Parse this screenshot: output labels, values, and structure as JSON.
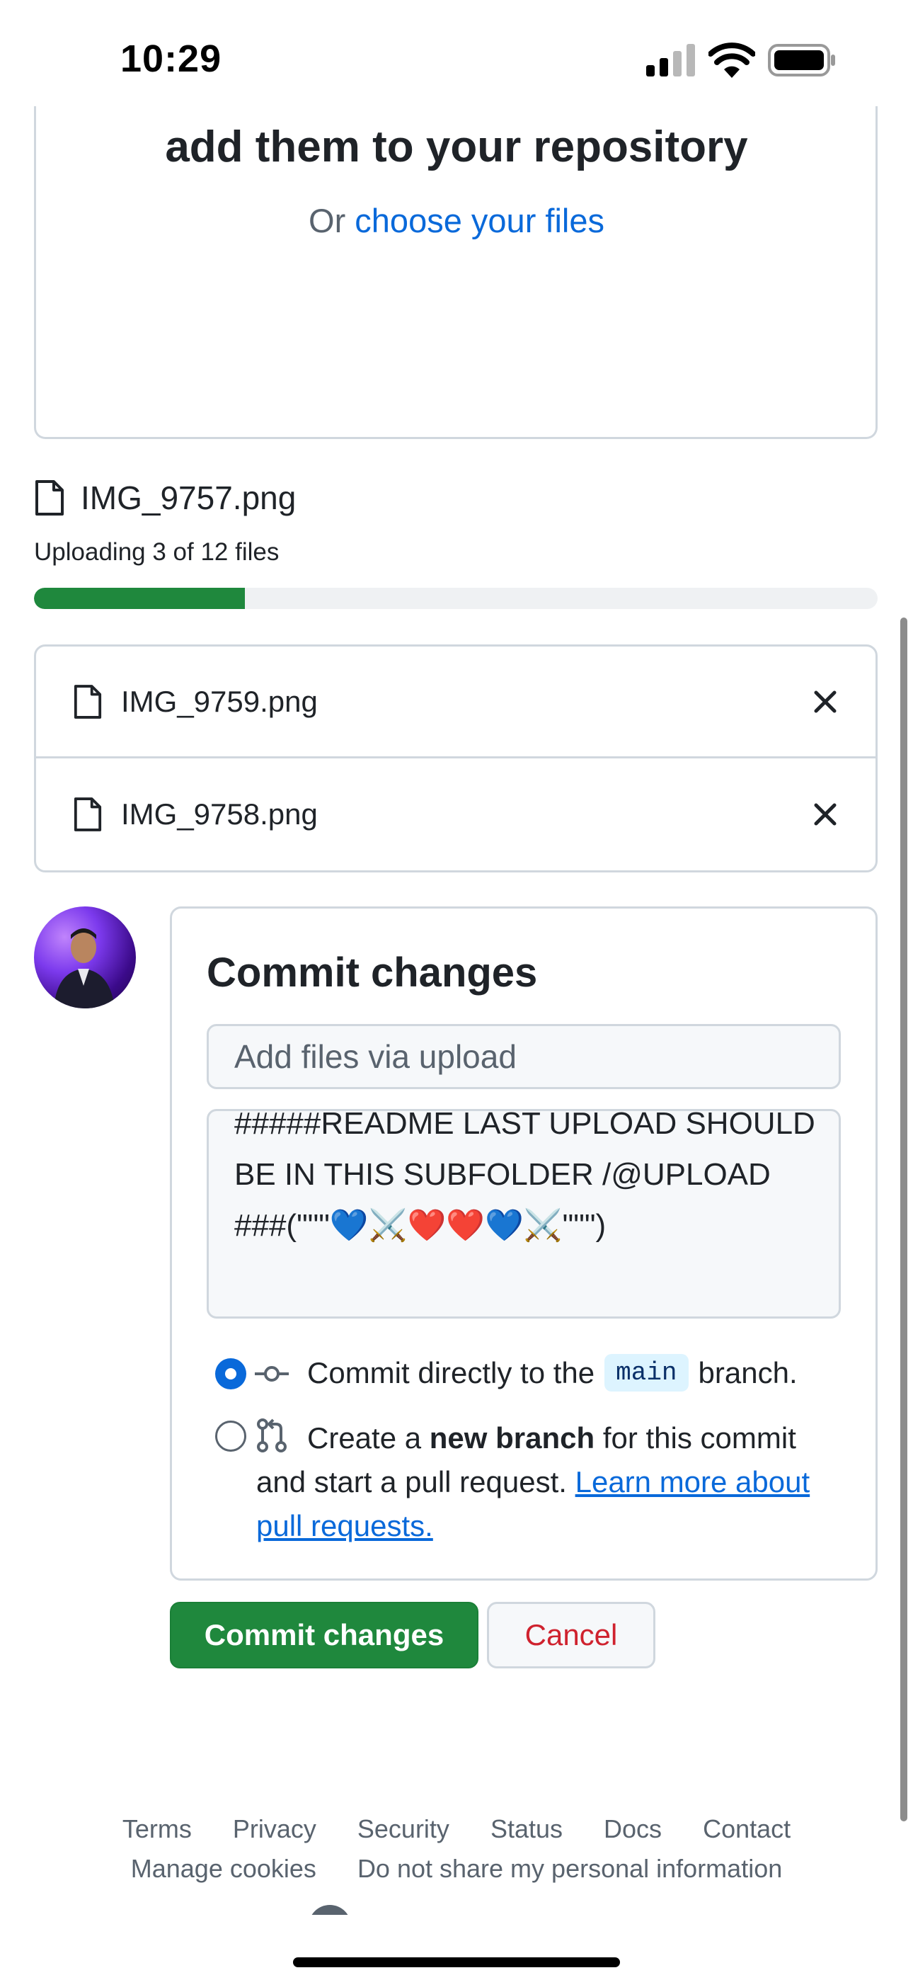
{
  "status_bar": {
    "time": "10:29",
    "icons": [
      "cellular-signal-icon",
      "wifi-icon",
      "battery-icon"
    ]
  },
  "dropzone": {
    "title": "add them to your repository",
    "subtitle_prefix": "Or ",
    "choose_link": "choose your files"
  },
  "upload": {
    "current_file": "IMG_9757.png",
    "status": "Uploading 3 of 12 files",
    "progress_percent": 25
  },
  "files": [
    {
      "name": "IMG_9759.png"
    },
    {
      "name": "IMG_9758.png"
    }
  ],
  "commit": {
    "title": "Commit changes",
    "summary_placeholder": "Add files via upload",
    "description": "#####README LAST UPLOAD SHOULD BE IN THIS SUBFOLDER /@UPLOAD ###(\"\"\"💙⚔️❤️❤️💙⚔️\"\"\")",
    "option_direct": {
      "prefix": "Commit directly to the",
      "branch": "main",
      "suffix": "branch."
    },
    "option_new_branch": {
      "prefix": "Create a ",
      "bold": "new branch",
      "middle": " for this commit and start a pull request. ",
      "link": "Learn more about pull requests."
    },
    "selected_option": "direct"
  },
  "buttons": {
    "commit": "Commit changes",
    "cancel": "Cancel"
  },
  "footer": {
    "row1": [
      "Terms",
      "Privacy",
      "Security",
      "Status",
      "Docs",
      "Contact"
    ],
    "row2": [
      "Manage cookies",
      "Do not share my personal information"
    ]
  },
  "colors": {
    "primary_green": "#1f883d",
    "link_blue": "#0969da",
    "danger_red": "#cf222e",
    "border": "#d0d7de"
  }
}
